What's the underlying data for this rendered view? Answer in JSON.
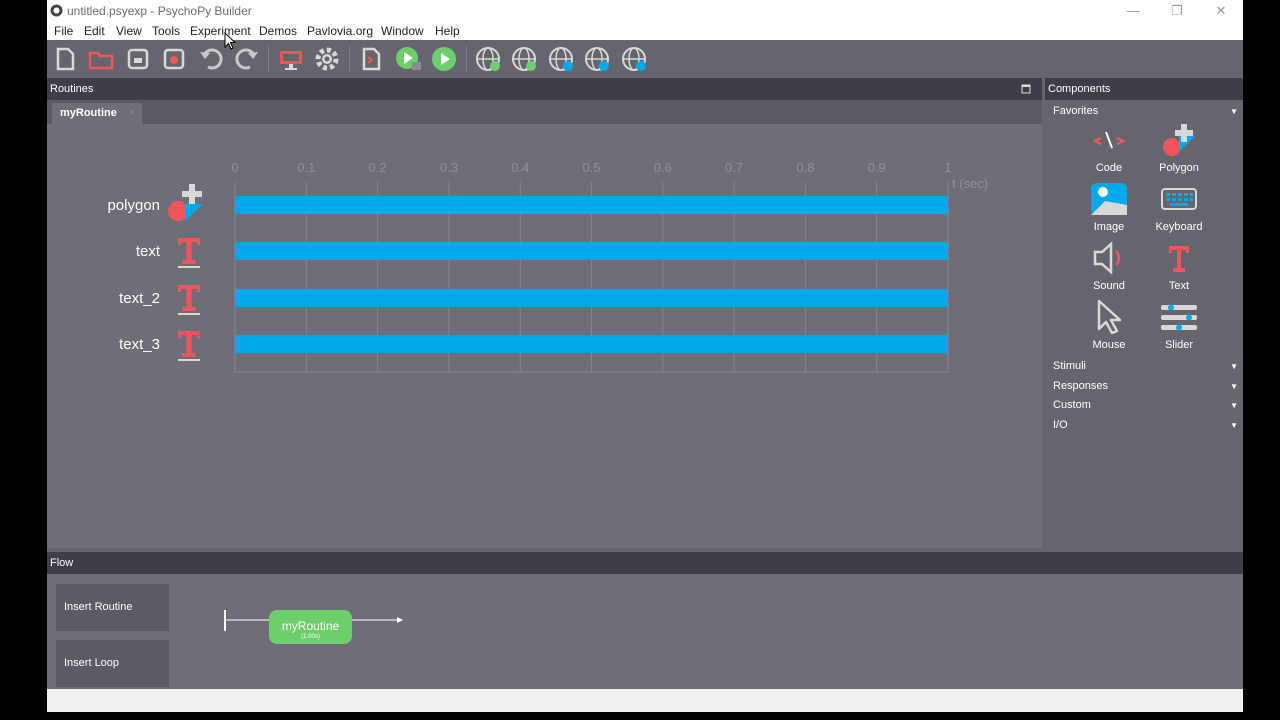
{
  "window": {
    "title": "untitled.psyexp - PsychoPy Builder"
  },
  "menu": [
    "File",
    "Edit",
    "View",
    "Tools",
    "Experiment",
    "Demos",
    "Pavlovia.org",
    "Window",
    "Help"
  ],
  "routines_panel": {
    "header": "Routines",
    "active_tab": "myRoutine",
    "tab_close": "×"
  },
  "timeline": {
    "ticks": [
      "0",
      "0.1",
      "0.2",
      "0.3",
      "0.4",
      "0.5",
      "0.6",
      "0.7",
      "0.8",
      "0.9",
      "1"
    ],
    "unit_label": "t (sec)",
    "rows": [
      {
        "name": "polygon",
        "icon": "polygon-icon",
        "start": 0,
        "stop": 1
      },
      {
        "name": "text",
        "icon": "text-icon",
        "start": 0,
        "stop": 1
      },
      {
        "name": "text_2",
        "icon": "text-icon",
        "start": 0,
        "stop": 1
      },
      {
        "name": "text_3",
        "icon": "text-icon",
        "start": 0,
        "stop": 1
      }
    ],
    "bar_color": "#02a9ea"
  },
  "components_panel": {
    "header": "Components",
    "favorites_label": "Favorites",
    "favorites": [
      {
        "label": "Code",
        "icon": "code-icon"
      },
      {
        "label": "Polygon",
        "icon": "polygon-icon"
      },
      {
        "label": "Image",
        "icon": "image-icon"
      },
      {
        "label": "Keyboard",
        "icon": "keyboard-icon"
      },
      {
        "label": "Sound",
        "icon": "sound-icon"
      },
      {
        "label": "Text",
        "icon": "text-icon"
      },
      {
        "label": "Mouse",
        "icon": "mouse-icon"
      },
      {
        "label": "Slider",
        "icon": "slider-icon"
      }
    ],
    "categories": [
      "Stimuli",
      "Responses",
      "Custom",
      "I/O"
    ]
  },
  "flow_panel": {
    "header": "Flow",
    "insert_routine": "Insert Routine",
    "insert_loop": "Insert Loop",
    "routine": {
      "name": "myRoutine",
      "duration": "(1.00s)"
    }
  },
  "colors": {
    "accent_red": "#f2545b",
    "accent_blue": "#02a9ea",
    "routine_green": "#6ccf6c"
  }
}
